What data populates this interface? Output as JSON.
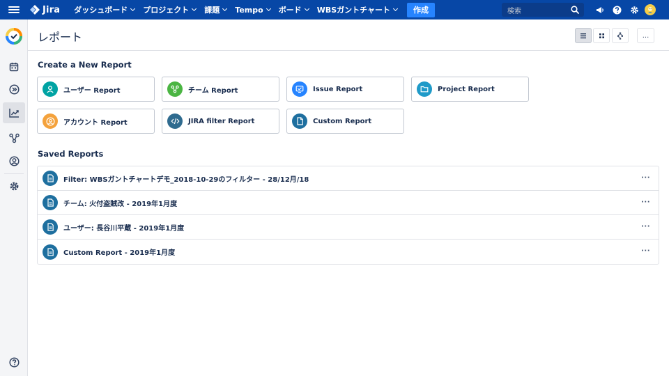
{
  "app": {
    "name": "Jira"
  },
  "nav": {
    "items": [
      {
        "label": "ダッシュボード"
      },
      {
        "label": "プロジェクト"
      },
      {
        "label": "課題"
      },
      {
        "label": "Tempo"
      },
      {
        "label": "ボード"
      },
      {
        "label": "WBSガントチャート"
      }
    ],
    "create_label": "作成",
    "search_placeholder": "検索"
  },
  "page": {
    "title": "レポート",
    "more_label": "..."
  },
  "create_section": {
    "title": "Create a New Report",
    "cards": [
      {
        "label": "ユーザー Report",
        "icon": "user-icon",
        "color": "#00a3a3"
      },
      {
        "label": "チーム Report",
        "icon": "team-icon",
        "color": "#4bb543"
      },
      {
        "label": "Issue Report",
        "icon": "issue-icon",
        "color": "#2684ff"
      },
      {
        "label": "Project Report",
        "icon": "folder-icon",
        "color": "#1f9ac8"
      },
      {
        "label": "アカウント Report",
        "icon": "account-icon",
        "color": "#f4a23c"
      },
      {
        "label": "JIRA filter Report",
        "icon": "code-icon",
        "color": "#2f6b8f"
      },
      {
        "label": "Custom Report",
        "icon": "document-icon",
        "color": "#1e6f9f"
      }
    ]
  },
  "saved_section": {
    "title": "Saved Reports",
    "rows": [
      {
        "label": "Filter: WBSガントチャートデモ_2018-10-29のフィルター - 28/12月/18"
      },
      {
        "label": "チーム: 火付盗賊改 - 2019年1月度"
      },
      {
        "label": "ユーザー: 長谷川平蔵 - 2019年1月度"
      },
      {
        "label": "Custom Report - 2019年1月度"
      }
    ],
    "more_label": "···"
  }
}
